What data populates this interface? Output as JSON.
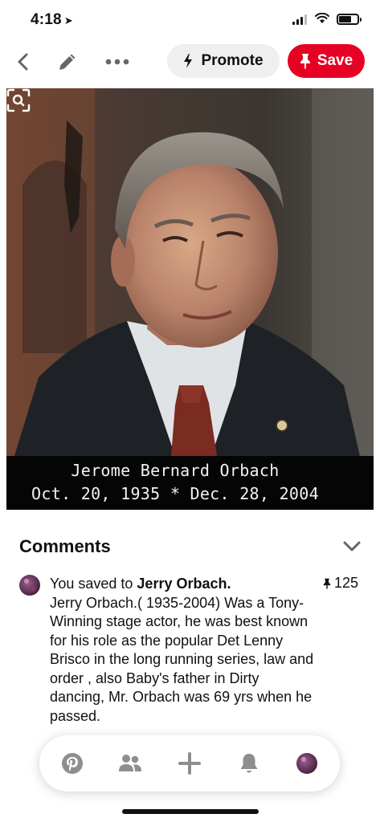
{
  "status_bar": {
    "time": "4:18",
    "location_arrow": "location-arrow-icon"
  },
  "toolbar": {
    "back_icon": "chevron-left-icon",
    "edit_icon": "pencil-icon",
    "more_icon": "more-dots-icon",
    "promote_label": "Promote",
    "save_label": "Save",
    "accent_color": "#e60023"
  },
  "pin": {
    "caption_line1": "Jerome Bernard Orbach",
    "caption_line2": "Oct. 20, 1935 * Dec. 28, 2004",
    "visual_search_icon": "visual-search-icon"
  },
  "comments": {
    "header": "Comments",
    "saved_prefix": "You saved to ",
    "board_name": "Jerry Orbach.",
    "description": "Jerry Orbach.( 1935-2004) Was a Tony-Winning stage actor, he was best known for his role as the popular Det Lenny Brisco in the long running series, law and order , also Baby's father in Dirty dancing, Mr. Orbach was 69 yrs when he passed.",
    "save_count": "125"
  },
  "bottom_nav": {
    "items": [
      "pinterest-home-icon",
      "following-icon",
      "create-plus-icon",
      "notifications-bell-icon",
      "profile-avatar"
    ]
  }
}
